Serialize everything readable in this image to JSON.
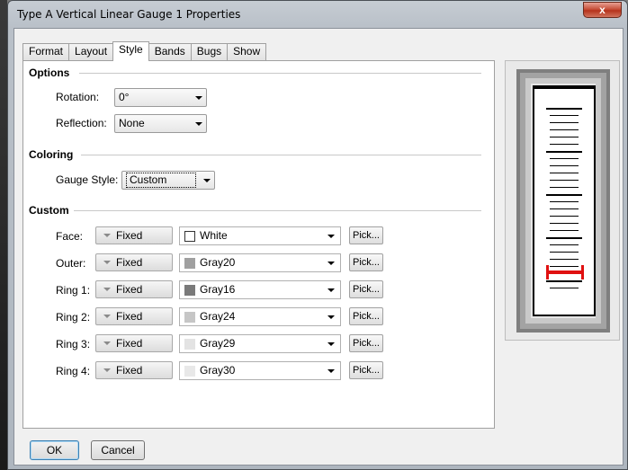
{
  "window": {
    "title": "Type A Vertical Linear Gauge 1 Properties",
    "close_glyph": "x"
  },
  "tabs": [
    {
      "label": "Format"
    },
    {
      "label": "Layout"
    },
    {
      "label": "Style"
    },
    {
      "label": "Bands"
    },
    {
      "label": "Bugs"
    },
    {
      "label": "Show"
    }
  ],
  "active_tab": "Style",
  "options": {
    "title": "Options",
    "rotation_label": "Rotation:",
    "rotation_value": "0°",
    "reflection_label": "Reflection:",
    "reflection_value": "None"
  },
  "coloring": {
    "title": "Coloring",
    "gauge_style_label": "Gauge Style:",
    "gauge_style_value": "Custom"
  },
  "custom": {
    "title": "Custom",
    "rows": [
      {
        "label": "Face:",
        "mode": "Fixed",
        "color_name": "White",
        "swatch": "#ffffff",
        "pick": "Pick..."
      },
      {
        "label": "Outer:",
        "mode": "Fixed",
        "color_name": "Gray20",
        "swatch": "#a0a0a0",
        "pick": "Pick..."
      },
      {
        "label": "Ring 1:",
        "mode": "Fixed",
        "color_name": "Gray16",
        "swatch": "#7a7a7a",
        "pick": "Pick..."
      },
      {
        "label": "Ring 2:",
        "mode": "Fixed",
        "color_name": "Gray24",
        "swatch": "#c6c6c6",
        "pick": "Pick..."
      },
      {
        "label": "Ring 3:",
        "mode": "Fixed",
        "color_name": "Gray29",
        "swatch": "#e3e3e3",
        "pick": "Pick..."
      },
      {
        "label": "Ring 4:",
        "mode": "Fixed",
        "color_name": "Gray30",
        "swatch": "#e8e8e8",
        "pick": "Pick..."
      }
    ]
  },
  "buttons": {
    "ok": "OK",
    "cancel": "Cancel"
  },
  "preview_colors": {
    "outer": "#7f7f7f",
    "ring1": "#a3a3a3",
    "ring2": "#c9c9c9",
    "ring3": "#e6e6e6",
    "face": "#ffffff",
    "ticks": "#000000",
    "pointer": "#e01010"
  }
}
